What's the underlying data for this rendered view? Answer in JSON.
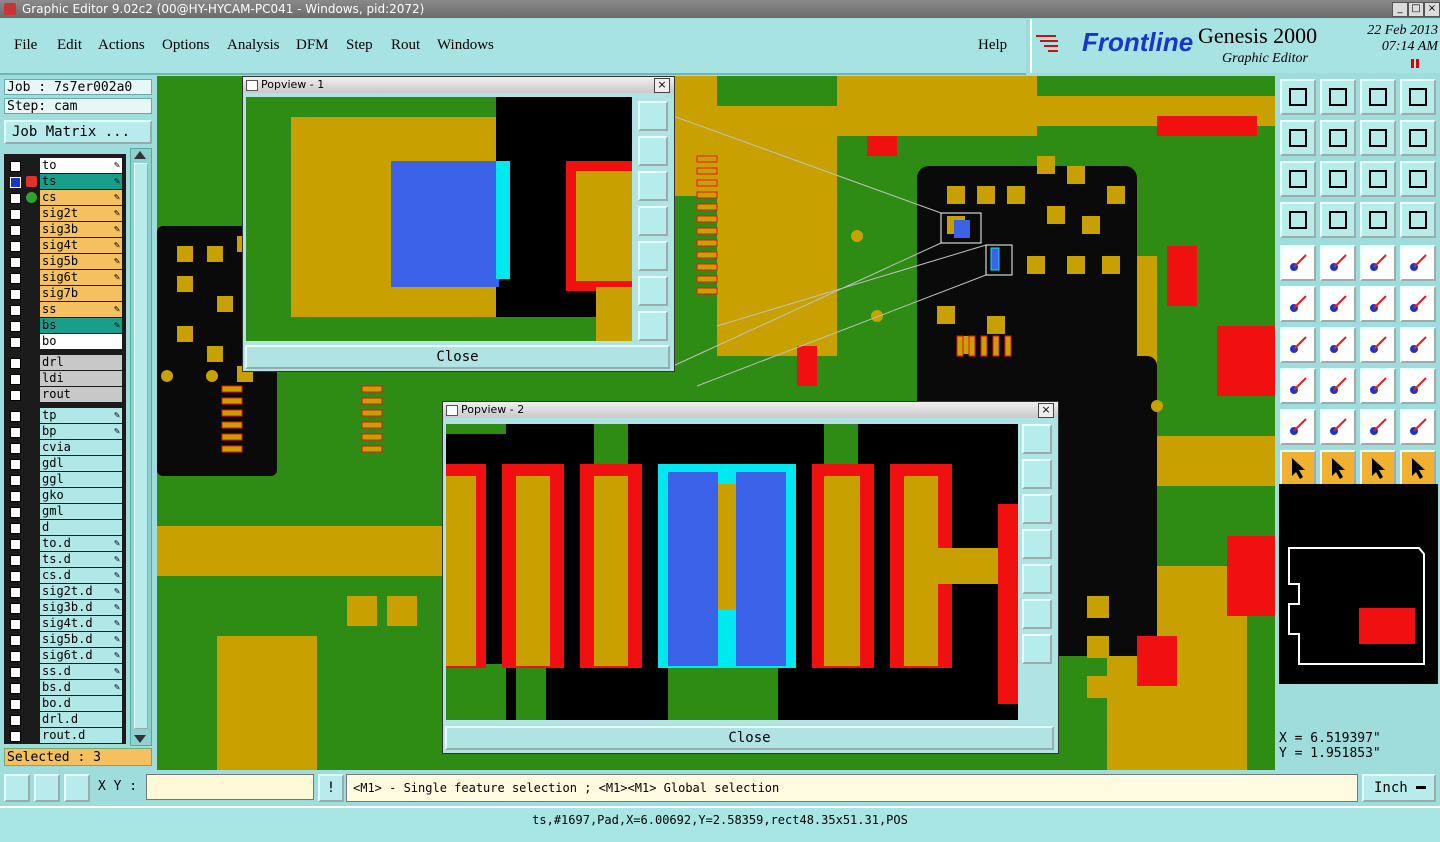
{
  "window": {
    "title": "Graphic Editor 9.02c2 (00@HY-HYCAM-PC041 - Windows, pid:2072)"
  },
  "menu": {
    "file": "File",
    "edit": "Edit",
    "actions": "Actions",
    "options": "Options",
    "analysis": "Analysis",
    "dfm": "DFM",
    "step": "Step",
    "rout": "Rout",
    "windows": "Windows",
    "help": "Help"
  },
  "brand": {
    "name": "Frontline",
    "product": "Genesis 2000",
    "subtitle": "Graphic Editor",
    "date": "22 Feb 2013",
    "time": "07:14 AM"
  },
  "job": {
    "job_label": "Job : 7s7er002a0",
    "step_label": "Step: cam",
    "matrix_button": "Job Matrix ..."
  },
  "layers": [
    {
      "name": "to",
      "color": "#ffffff",
      "edit": true
    },
    {
      "name": "ts",
      "color": "#1a9e8c",
      "edit": true,
      "active": true
    },
    {
      "name": "cs",
      "color": "#f4c060",
      "edit": true
    },
    {
      "name": "sig2t",
      "color": "#f4c060",
      "edit": true
    },
    {
      "name": "sig3b",
      "color": "#f4c060",
      "edit": true
    },
    {
      "name": "sig4t",
      "color": "#f4c060",
      "edit": true
    },
    {
      "name": "sig5b",
      "color": "#f4c060",
      "edit": true
    },
    {
      "name": "sig6t",
      "color": "#f4c060",
      "edit": true
    },
    {
      "name": "sig7b",
      "color": "#f4c060",
      "edit": false
    },
    {
      "name": "ss",
      "color": "#f4c060",
      "edit": true
    },
    {
      "name": "bs",
      "color": "#1a9e8c",
      "edit": true
    },
    {
      "name": "bo",
      "color": "#ffffff",
      "edit": false
    },
    {
      "name": "drl",
      "color": "#c8c8c8",
      "edit": false,
      "gap": true
    },
    {
      "name": "ldi",
      "color": "#c8c8c8",
      "edit": false
    },
    {
      "name": "rout",
      "color": "#c8c8c8",
      "edit": false
    },
    {
      "name": "tp",
      "color": "#b0e8e8",
      "edit": true,
      "gap": true
    },
    {
      "name": "bp",
      "color": "#b0e8e8",
      "edit": true
    },
    {
      "name": "cvia",
      "color": "#b0e8e8",
      "edit": false
    },
    {
      "name": "gdl",
      "color": "#b0e8e8",
      "edit": false
    },
    {
      "name": "ggl",
      "color": "#b0e8e8",
      "edit": false
    },
    {
      "name": "gko",
      "color": "#b0e8e8",
      "edit": false
    },
    {
      "name": "gml",
      "color": "#b0e8e8",
      "edit": false
    },
    {
      "name": "d",
      "color": "#b0e8e8",
      "edit": false
    },
    {
      "name": "to.d",
      "color": "#b0e8e8",
      "edit": true
    },
    {
      "name": "ts.d",
      "color": "#b0e8e8",
      "edit": true
    },
    {
      "name": "cs.d",
      "color": "#b0e8e8",
      "edit": true
    },
    {
      "name": "sig2t.d",
      "color": "#b0e8e8",
      "edit": true
    },
    {
      "name": "sig3b.d",
      "color": "#b0e8e8",
      "edit": true
    },
    {
      "name": "sig4t.d",
      "color": "#b0e8e8",
      "edit": true
    },
    {
      "name": "sig5b.d",
      "color": "#b0e8e8",
      "edit": true
    },
    {
      "name": "sig6t.d",
      "color": "#b0e8e8",
      "edit": true
    },
    {
      "name": "ss.d",
      "color": "#b0e8e8",
      "edit": true
    },
    {
      "name": "bs.d",
      "color": "#b0e8e8",
      "edit": true
    },
    {
      "name": "bo.d",
      "color": "#b0e8e8",
      "edit": false
    },
    {
      "name": "drl.d",
      "color": "#b0e8e8",
      "edit": false
    },
    {
      "name": "rout.d",
      "color": "#b0e8e8",
      "edit": false
    }
  ],
  "selection": {
    "label": "Selected : 3"
  },
  "popup1": {
    "title": "Popview - 1",
    "close": "Close"
  },
  "popup2": {
    "title": "Popview - 2",
    "close": "Close"
  },
  "coords": {
    "x": "X = 6.519397\"",
    "y": "Y = 1.951853\""
  },
  "bottom": {
    "xy_label": "X Y :",
    "xy_value": "",
    "hint": "<M1> - Single feature selection ; <M1><M1> Global selection",
    "unit": "Inch"
  },
  "status": {
    "text": "ts,#1697,Pad,X=6.00692,Y=2.58359,rect48.35x51.31,POS"
  },
  "colors": {
    "board_green": "#2e8c14",
    "copper": "#c8a000",
    "pad_red": "#f01010",
    "selection_blue": "#3b62e8",
    "highlight_cyan": "#00e8f0"
  }
}
